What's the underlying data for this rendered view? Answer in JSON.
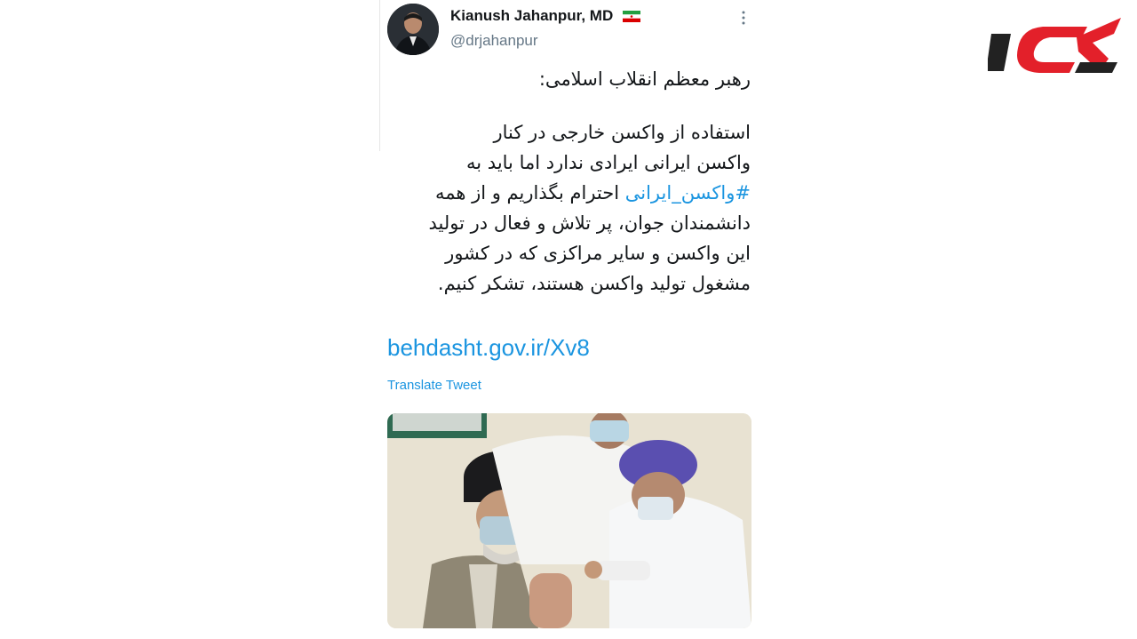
{
  "tweet": {
    "display_name": "Kianush Jahanpur, MD",
    "flag_icon": "iran-flag-icon",
    "handle": "@drjahanpur",
    "body_line_1": "رهبر معظم انقلاب اسلامی:",
    "body_line_2": "استفاده از واکسن خارجی در کنار",
    "body_line_3": "واکسن ایرانی ایرادی ندارد اما باید به",
    "hashtag": "#واکسن_ایرانی",
    "body_line_4_rest": " احترام بگذاریم و از همه",
    "body_line_5": "دانشمندان جوان، پر تلاش و فعال در تولید",
    "body_line_6": "این واکسن و سایر مراکزی که در کشور",
    "body_line_7": "مشغول تولید واکسن هستند، تشکر کنیم.",
    "link": "behdasht.gov.ir/Xv8",
    "translate_label": "Translate Tweet"
  },
  "brand": {
    "logo": "rokna-logo",
    "logo_color": "#e3202a",
    "logo_dark": "#222222"
  },
  "colors": {
    "accent": "#1b95e0",
    "text": "#14171a",
    "muted": "#657786"
  }
}
